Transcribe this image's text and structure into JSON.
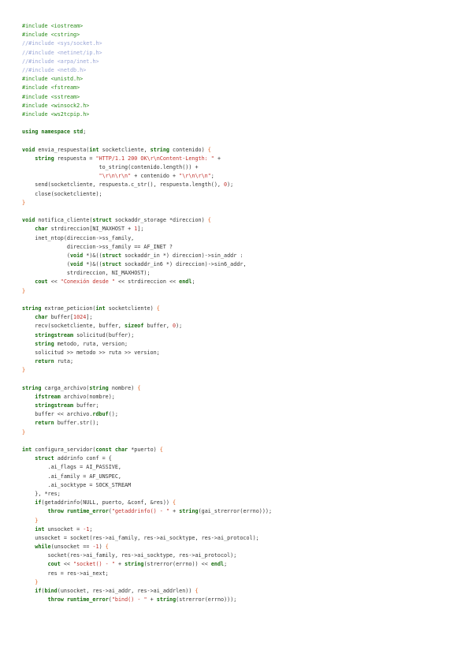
{
  "document": {
    "language": "cpp",
    "lines": [
      [
        [
          "pre",
          "#include <iostream>"
        ]
      ],
      [
        [
          "pre",
          "#include <cstring>"
        ]
      ],
      [
        [
          "com",
          "//#include <sys/socket.h>"
        ]
      ],
      [
        [
          "com",
          "//#include <netinet/ip.h>"
        ]
      ],
      [
        [
          "com",
          "//#include <arpa/inet.h>"
        ]
      ],
      [
        [
          "com",
          "//#include <netdb.h>"
        ]
      ],
      [
        [
          "pre",
          "#include <unistd.h>"
        ]
      ],
      [
        [
          "pre",
          "#include <fstream>"
        ]
      ],
      [
        [
          "pre",
          "#include <sstream>"
        ]
      ],
      [
        [
          "pre",
          "#include <winsock2.h>"
        ]
      ],
      [
        [
          "pre",
          "#include <ws2tcpip.h>"
        ]
      ],
      [],
      [
        [
          "kw",
          "using namespace"
        ],
        [
          "txt",
          " "
        ],
        [
          "kw",
          "std"
        ],
        [
          "txt",
          ";"
        ]
      ],
      [],
      [
        [
          "kw",
          "void"
        ],
        [
          "txt",
          " envia_respuesta("
        ],
        [
          "kw",
          "int"
        ],
        [
          "txt",
          " socketcliente, "
        ],
        [
          "kw",
          "string"
        ],
        [
          "txt",
          " contenido) "
        ],
        [
          "op",
          "{"
        ]
      ],
      [
        [
          "txt",
          "    "
        ],
        [
          "kw",
          "string"
        ],
        [
          "txt",
          " respuesta = "
        ],
        [
          "str",
          "\"HTTP/1.1 200 OK\\r\\nContent-Length: \""
        ],
        [
          "txt",
          " +"
        ]
      ],
      [
        [
          "txt",
          "                        to_string(contenido.length()) +"
        ]
      ],
      [
        [
          "txt",
          "                        "
        ],
        [
          "str",
          "\"\\r\\n\\r\\n\""
        ],
        [
          "txt",
          " + contenido + "
        ],
        [
          "str",
          "\"\\r\\n\\r\\n\""
        ],
        [
          "txt",
          ";"
        ]
      ],
      [
        [
          "txt",
          "    send(socketcliente, respuesta.c_str(), respuesta.length(), "
        ],
        [
          "num",
          "0"
        ],
        [
          "txt",
          ");"
        ]
      ],
      [
        [
          "txt",
          "    close(socketcliente);"
        ]
      ],
      [
        [
          "op",
          "}"
        ]
      ],
      [],
      [
        [
          "kw",
          "void"
        ],
        [
          "txt",
          " notifica_cliente("
        ],
        [
          "kw",
          "struct"
        ],
        [
          "txt",
          " sockaddr_storage *direccion) "
        ],
        [
          "op",
          "{"
        ]
      ],
      [
        [
          "txt",
          "    "
        ],
        [
          "kw",
          "char"
        ],
        [
          "txt",
          " strdireccion[NI_MAXHOST + "
        ],
        [
          "num",
          "1"
        ],
        [
          "txt",
          "];"
        ]
      ],
      [
        [
          "txt",
          "    inet_ntop(direccion->ss_family,"
        ]
      ],
      [
        [
          "txt",
          "              direccion->ss_family == AF_INET ?"
        ]
      ],
      [
        [
          "txt",
          "              ("
        ],
        [
          "kw",
          "void"
        ],
        [
          "txt",
          " *)&(("
        ],
        [
          "kw",
          "struct"
        ],
        [
          "txt",
          " sockaddr_in *) direccion)->sin_addr :"
        ]
      ],
      [
        [
          "txt",
          "              ("
        ],
        [
          "kw",
          "void"
        ],
        [
          "txt",
          " *)&(("
        ],
        [
          "kw",
          "struct"
        ],
        [
          "txt",
          " sockaddr_in6 *) direccion)->sin6_addr,"
        ]
      ],
      [
        [
          "txt",
          "              strdireccion, NI_MAXHOST);"
        ]
      ],
      [
        [
          "txt",
          "    "
        ],
        [
          "kw",
          "cout"
        ],
        [
          "txt",
          " << "
        ],
        [
          "str",
          "\"Conexión desde \""
        ],
        [
          "txt",
          " << strdireccion << "
        ],
        [
          "kw",
          "endl"
        ],
        [
          "txt",
          ";"
        ]
      ],
      [
        [
          "op",
          "}"
        ]
      ],
      [],
      [
        [
          "kw",
          "string"
        ],
        [
          "txt",
          " extrae_peticion("
        ],
        [
          "kw",
          "int"
        ],
        [
          "txt",
          " socketcliente) "
        ],
        [
          "op",
          "{"
        ]
      ],
      [
        [
          "txt",
          "    "
        ],
        [
          "kw",
          "char"
        ],
        [
          "txt",
          " buffer["
        ],
        [
          "num",
          "1024"
        ],
        [
          "txt",
          "];"
        ]
      ],
      [
        [
          "txt",
          "    recv(socketcliente, buffer, "
        ],
        [
          "kw",
          "sizeof"
        ],
        [
          "txt",
          " buffer, "
        ],
        [
          "num",
          "0"
        ],
        [
          "txt",
          ");"
        ]
      ],
      [
        [
          "txt",
          "    "
        ],
        [
          "kw",
          "stringstream"
        ],
        [
          "txt",
          " solicitud(buffer);"
        ]
      ],
      [
        [
          "txt",
          "    "
        ],
        [
          "kw",
          "string"
        ],
        [
          "txt",
          " metodo, ruta, version;"
        ]
      ],
      [
        [
          "txt",
          "    solicitud >> metodo >> ruta >> version;"
        ]
      ],
      [
        [
          "txt",
          "    "
        ],
        [
          "kw",
          "return"
        ],
        [
          "txt",
          " ruta;"
        ]
      ],
      [
        [
          "op",
          "}"
        ]
      ],
      [],
      [
        [
          "kw",
          "string"
        ],
        [
          "txt",
          " carga_archivo("
        ],
        [
          "kw",
          "string"
        ],
        [
          "txt",
          " nombre) "
        ],
        [
          "op",
          "{"
        ]
      ],
      [
        [
          "txt",
          "    "
        ],
        [
          "kw",
          "ifstream"
        ],
        [
          "txt",
          " archivo(nombre);"
        ]
      ],
      [
        [
          "txt",
          "    "
        ],
        [
          "kw",
          "stringstream"
        ],
        [
          "txt",
          " buffer;"
        ]
      ],
      [
        [
          "txt",
          "    buffer << archivo."
        ],
        [
          "kw",
          "rdbuf"
        ],
        [
          "txt",
          "();"
        ]
      ],
      [
        [
          "txt",
          "    "
        ],
        [
          "kw",
          "return"
        ],
        [
          "txt",
          " buffer.str();"
        ]
      ],
      [
        [
          "op",
          "}"
        ]
      ],
      [],
      [
        [
          "kw",
          "int"
        ],
        [
          "txt",
          " configura_servidor("
        ],
        [
          "kw",
          "const char"
        ],
        [
          "txt",
          " *puerto) "
        ],
        [
          "op",
          "{"
        ]
      ],
      [
        [
          "txt",
          "    "
        ],
        [
          "kw",
          "struct"
        ],
        [
          "txt",
          " addrinfo conf = {"
        ]
      ],
      [
        [
          "txt",
          "        .ai_flags = AI_PASSIVE,"
        ]
      ],
      [
        [
          "txt",
          "        .ai_family = AF_UNSPEC,"
        ]
      ],
      [
        [
          "txt",
          "        .ai_socktype = SOCK_STREAM"
        ]
      ],
      [
        [
          "txt",
          "    }, *res;"
        ]
      ],
      [
        [
          "txt",
          "    "
        ],
        [
          "kw",
          "if"
        ],
        [
          "txt",
          "(getaddrinfo(NULL, puerto, &conf, &res)) "
        ],
        [
          "op",
          "{"
        ]
      ],
      [
        [
          "txt",
          "        "
        ],
        [
          "kw",
          "throw"
        ],
        [
          "txt",
          " "
        ],
        [
          "kw",
          "runtime_error"
        ],
        [
          "txt",
          "("
        ],
        [
          "str",
          "\"getaddrinfo() - \""
        ],
        [
          "txt",
          " + "
        ],
        [
          "kw",
          "string"
        ],
        [
          "txt",
          "(gai_strerror(errno)));"
        ]
      ],
      [
        [
          "txt",
          "    "
        ],
        [
          "op",
          "}"
        ]
      ],
      [
        [
          "txt",
          "    "
        ],
        [
          "kw",
          "int"
        ],
        [
          "txt",
          " unsocket = "
        ],
        [
          "num",
          "-1"
        ],
        [
          "txt",
          ";"
        ]
      ],
      [
        [
          "txt",
          "    unsocket = socket(res->ai_family, res->ai_socktype, res->ai_protocol);"
        ]
      ],
      [
        [
          "txt",
          "    "
        ],
        [
          "kw",
          "while"
        ],
        [
          "txt",
          "(unsocket == "
        ],
        [
          "num",
          "-1"
        ],
        [
          "txt",
          ") "
        ],
        [
          "op",
          "{"
        ]
      ],
      [
        [
          "txt",
          "        socket(res->ai_family, res->ai_socktype, res->ai_protocol);"
        ]
      ],
      [
        [
          "txt",
          "        "
        ],
        [
          "kw",
          "cout"
        ],
        [
          "txt",
          " << "
        ],
        [
          "str",
          "\"socket() - \""
        ],
        [
          "txt",
          " + "
        ],
        [
          "kw",
          "string"
        ],
        [
          "txt",
          "(strerror(errno)) << "
        ],
        [
          "kw",
          "endl"
        ],
        [
          "txt",
          ";"
        ]
      ],
      [
        [
          "txt",
          "        res = res->ai_next;"
        ]
      ],
      [
        [
          "txt",
          "    "
        ],
        [
          "op",
          "}"
        ]
      ],
      [
        [
          "txt",
          "    "
        ],
        [
          "kw",
          "if"
        ],
        [
          "txt",
          "("
        ],
        [
          "kw",
          "bind"
        ],
        [
          "txt",
          "(unsocket, res->ai_addr, res->ai_addrlen)) "
        ],
        [
          "op",
          "{"
        ]
      ],
      [
        [
          "txt",
          "        "
        ],
        [
          "kw",
          "throw"
        ],
        [
          "txt",
          " "
        ],
        [
          "kw",
          "runtime_error"
        ],
        [
          "txt",
          "("
        ],
        [
          "str",
          "\"bind() - \""
        ],
        [
          "txt",
          " + "
        ],
        [
          "kw",
          "string"
        ],
        [
          "txt",
          "(strerror(errno)));"
        ]
      ]
    ]
  }
}
